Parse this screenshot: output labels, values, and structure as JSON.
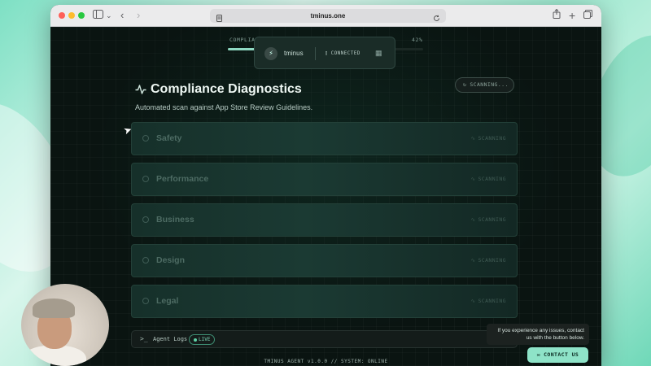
{
  "browser": {
    "url": "tminus.one",
    "icons": {
      "sidebar": "sidebar-icon",
      "back": "back-icon",
      "forward": "forward-icon",
      "page": "page-icon",
      "reload": "reload-icon",
      "share": "share-icon",
      "new_tab": "plus-icon",
      "tabs": "tabs-icon"
    }
  },
  "progress": {
    "label": "COMPLIA",
    "percent_label": "42%",
    "percent": 42
  },
  "connection": {
    "name": "tminus",
    "status": "CONNECTED"
  },
  "header": {
    "title": "Compliance Diagnostics",
    "subtitle": "Automated scan against App Store Review Guidelines.",
    "badge": "SCANNING..."
  },
  "categories": [
    {
      "label": "Safety",
      "status": "SCANNING"
    },
    {
      "label": "Performance",
      "status": "SCANNING"
    },
    {
      "label": "Business",
      "status": "SCANNING"
    },
    {
      "label": "Design",
      "status": "SCANNING"
    },
    {
      "label": "Legal",
      "status": "SCANNING"
    }
  ],
  "logs": {
    "prompt": ">_",
    "label": "Agent Logs",
    "live": "LIVE"
  },
  "footer": "TMINUS AGENT v1.0.0 // SYSTEM: ONLINE",
  "support": {
    "tooltip": "If you experience any issues, contact us with the button below.",
    "button": "CONTACT US"
  },
  "colors": {
    "accent": "#8ee3c8",
    "background": "#0a1411",
    "card": "#1b3a33"
  }
}
